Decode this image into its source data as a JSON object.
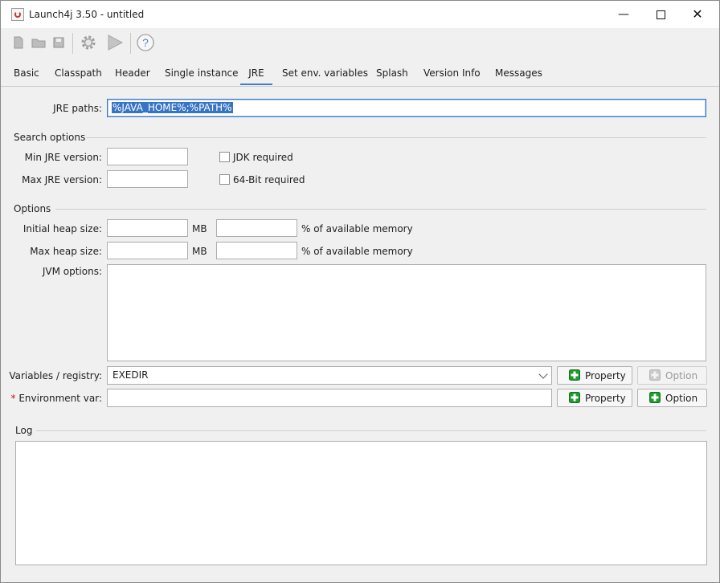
{
  "window": {
    "title": "Launch4j 3.50 - untitled",
    "minimize": "—",
    "close": "✕"
  },
  "tabs": [
    "Basic",
    "Classpath",
    "Header",
    "Single instance",
    "JRE",
    "Set env. variables",
    "Splash",
    "Version Info",
    "Messages"
  ],
  "jre": {
    "paths_label": "JRE paths:",
    "paths_value": "%JAVA_HOME%;%PATH%"
  },
  "search": {
    "title": "Search options",
    "min_label": "Min JRE version:",
    "max_label": "Max JRE version:",
    "jdk_required": "JDK required",
    "bit64_required": "64-Bit required"
  },
  "options": {
    "title": "Options",
    "initial_heap_label": "Initial heap size:",
    "max_heap_label": "Max heap size:",
    "mb": "MB",
    "percent_label": "% of available memory",
    "jvm_label": "JVM options:",
    "variables_label": "Variables / registry:",
    "variables_value": "EXEDIR",
    "env_required_mark": "*",
    "env_label": "Environment var:",
    "property_button": "Property",
    "option_button": "Option"
  },
  "log": {
    "title": "Log"
  },
  "colors": {
    "accent": "#3c7fd6",
    "selection": "#3874c4",
    "plus_green": "#1e9b2e",
    "required_star": "#d01010"
  },
  "icons": [
    "new-file-icon",
    "open-folder-icon",
    "save-icon",
    "settings-gear-icon",
    "run-play-icon",
    "help-icon",
    "plus-icon"
  ]
}
